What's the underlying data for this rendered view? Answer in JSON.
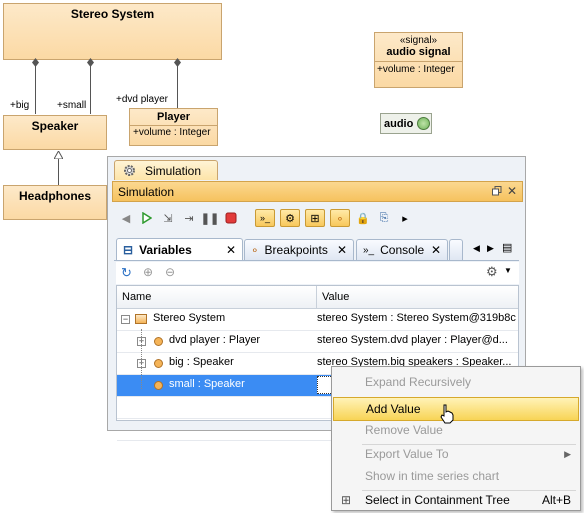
{
  "diagram": {
    "stereo_block": "Stereo System",
    "speaker_block": "Speaker",
    "headphones_block": "Headphones",
    "player_block": "Player",
    "player_attr": "+volume : Integer",
    "signal_stereotype": "«signal»",
    "signal_name": "audio signal",
    "signal_attr": "+volume : Integer",
    "port_label": "audio",
    "role_big": "+big",
    "role_small": "+small",
    "role_dvd": "+dvd player"
  },
  "sim_tab": "Simulation",
  "panel_title": "Simulation",
  "tabs": [
    {
      "label": "Variables"
    },
    {
      "label": "Breakpoints"
    },
    {
      "label": "Console"
    }
  ],
  "table": {
    "columns": [
      "Name",
      "Value"
    ],
    "rows": [
      {
        "name": "Stereo System",
        "value": "stereo System : Stereo System@319b8c"
      },
      {
        "name": "dvd player : Player",
        "value": "stereo System.dvd player : Player@d..."
      },
      {
        "name": "big : Speaker",
        "value": "stereo System.big speakers : Speaker..."
      },
      {
        "name": "small : Speaker",
        "value": ""
      }
    ]
  },
  "context_menu": {
    "items": [
      {
        "label": "Expand Recursively",
        "enabled": false
      },
      {
        "label": "Add Value",
        "enabled": true,
        "highlighted": true
      },
      {
        "label": "Remove Value",
        "enabled": false
      },
      {
        "label": "Export Value To",
        "enabled": false,
        "submenu": true
      },
      {
        "label": "Show in time series chart",
        "enabled": false
      },
      {
        "label": "Select in Containment Tree",
        "enabled": true,
        "shortcut": "Alt+B"
      }
    ]
  },
  "icons": {
    "sim_tab_icon": "gear-icon",
    "restore": "restore-window-icon",
    "close": "close-icon",
    "settings": "gear-icon",
    "cursor": "hand-pointer-icon"
  }
}
